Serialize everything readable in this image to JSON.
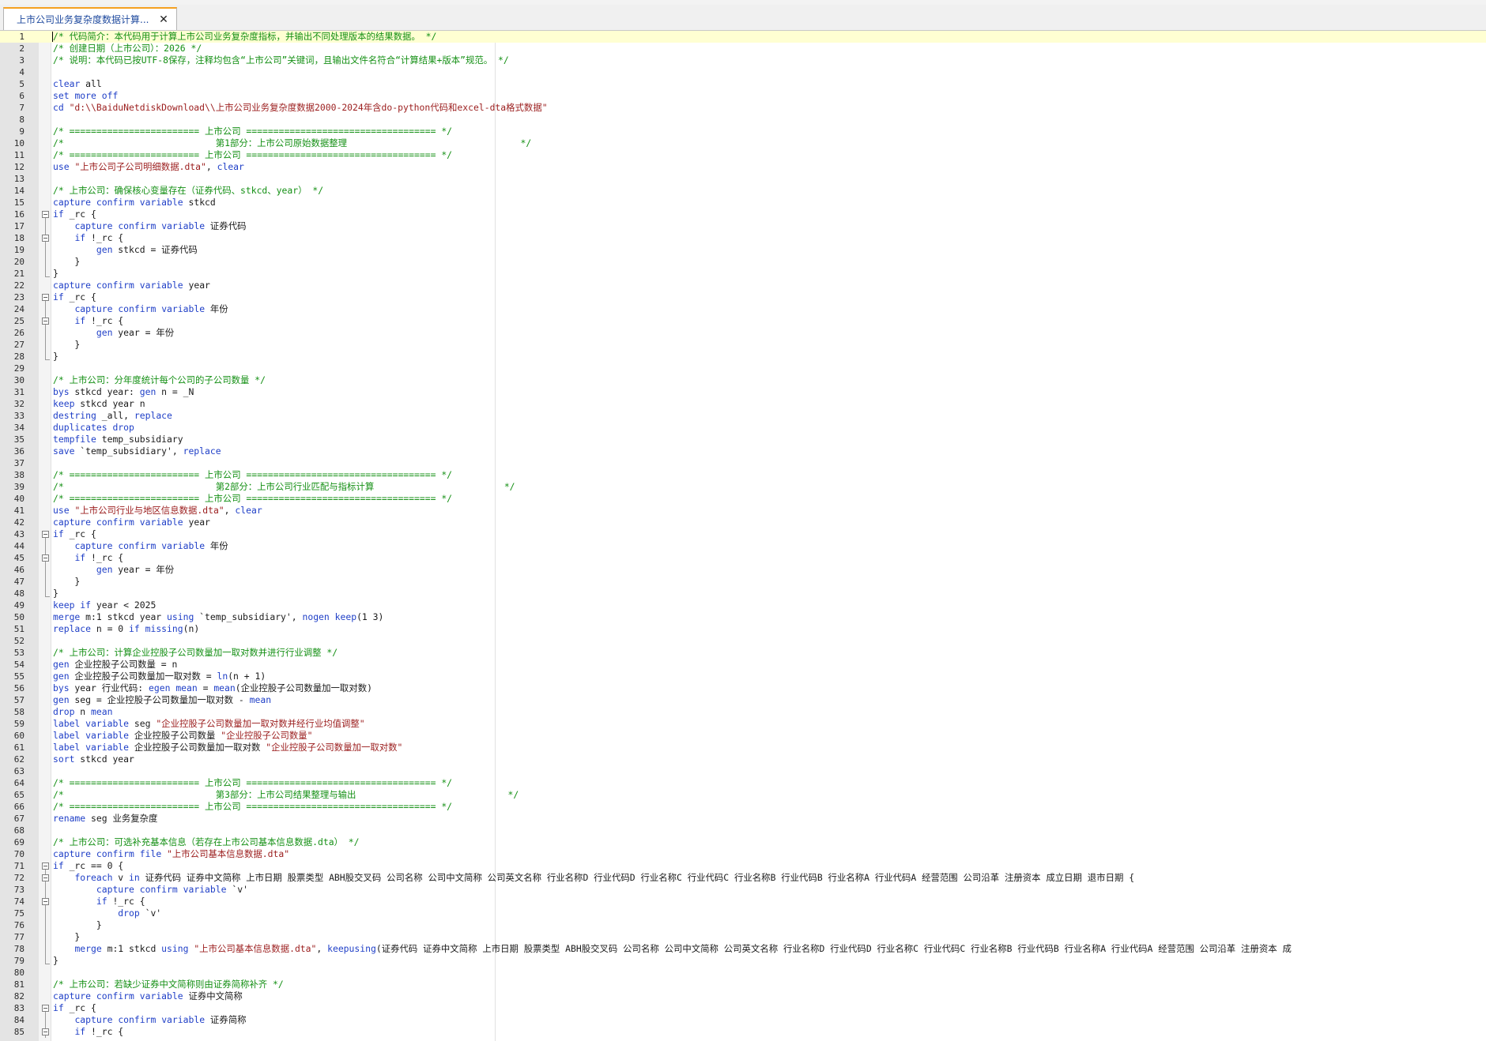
{
  "tabs": [
    {
      "label": "上市公司业务复杂度数据计算..."
    }
  ],
  "close_glyph": "✕",
  "colors": {
    "keyword": "#1f3fc7",
    "string": "#9b1d1d",
    "comment": "#159015",
    "text": "#1a1a1a",
    "current_line": "#ffffd2",
    "tab_accent": "#f5a020"
  },
  "editor": {
    "current_line": 1,
    "lines": [
      {
        "n": "1",
        "text": "/* 代码简介：本代码用于计算上市公司业务复杂度指标，并输出不同处理版本的结果数据。 */"
      },
      {
        "n": "2",
        "text": "/* 创建日期（上市公司）：2026 */"
      },
      {
        "n": "3",
        "text": "/* 说明：本代码已按UTF-8保存，注释均包含“上市公司”关键词，且输出文件名符合“计算结果+版本”规范。 */"
      },
      {
        "n": "4",
        "text": ""
      },
      {
        "n": "5",
        "text": "clear all"
      },
      {
        "n": "6",
        "text": "set more off"
      },
      {
        "n": "7",
        "text": "cd \"d:\\\\BaiduNetdiskDownload\\\\上市公司业务复杂度数据2000-2024年含do-python代码和excel-dta格式数据\""
      },
      {
        "n": "8",
        "text": ""
      },
      {
        "n": "9",
        "text": "/* ======================== 上市公司 =================================== */"
      },
      {
        "n": "10",
        "text": "/*                            第1部分：上市公司原始数据整理                                */"
      },
      {
        "n": "11",
        "text": "/* ======================== 上市公司 =================================== */"
      },
      {
        "n": "12",
        "text": "use \"上市公司子公司明细数据.dta\", clear"
      },
      {
        "n": "13",
        "text": ""
      },
      {
        "n": "14",
        "text": "/* 上市公司：确保核心变量存在（证券代码、stkcd、year） */"
      },
      {
        "n": "15",
        "text": "capture confirm variable stkcd"
      },
      {
        "n": "16",
        "text": "if _rc {"
      },
      {
        "n": "17",
        "text": "    capture confirm variable 证券代码"
      },
      {
        "n": "18",
        "text": "    if !_rc {"
      },
      {
        "n": "19",
        "text": "        gen stkcd = 证券代码"
      },
      {
        "n": "20",
        "text": "    }"
      },
      {
        "n": "21",
        "text": "}"
      },
      {
        "n": "22",
        "text": "capture confirm variable year"
      },
      {
        "n": "23",
        "text": "if _rc {"
      },
      {
        "n": "24",
        "text": "    capture confirm variable 年份"
      },
      {
        "n": "25",
        "text": "    if !_rc {"
      },
      {
        "n": "26",
        "text": "        gen year = 年份"
      },
      {
        "n": "27",
        "text": "    }"
      },
      {
        "n": "28",
        "text": "}"
      },
      {
        "n": "29",
        "text": ""
      },
      {
        "n": "30",
        "text": "/* 上市公司：分年度统计每个公司的子公司数量 */"
      },
      {
        "n": "31",
        "text": "bys stkcd year: gen n = _N"
      },
      {
        "n": "32",
        "text": "keep stkcd year n"
      },
      {
        "n": "33",
        "text": "destring _all, replace"
      },
      {
        "n": "34",
        "text": "duplicates drop"
      },
      {
        "n": "35",
        "text": "tempfile temp_subsidiary"
      },
      {
        "n": "36",
        "text": "save `temp_subsidiary', replace"
      },
      {
        "n": "37",
        "text": ""
      },
      {
        "n": "38",
        "text": "/* ======================== 上市公司 =================================== */"
      },
      {
        "n": "39",
        "text": "/*                            第2部分：上市公司行业匹配与指标计算                        */"
      },
      {
        "n": "40",
        "text": "/* ======================== 上市公司 =================================== */"
      },
      {
        "n": "41",
        "text": "use \"上市公司行业与地区信息数据.dta\", clear"
      },
      {
        "n": "42",
        "text": "capture confirm variable year"
      },
      {
        "n": "43",
        "text": "if _rc {"
      },
      {
        "n": "44",
        "text": "    capture confirm variable 年份"
      },
      {
        "n": "45",
        "text": "    if !_rc {"
      },
      {
        "n": "46",
        "text": "        gen year = 年份"
      },
      {
        "n": "47",
        "text": "    }"
      },
      {
        "n": "48",
        "text": "}"
      },
      {
        "n": "49",
        "text": "keep if year < 2025"
      },
      {
        "n": "50",
        "text": "merge m:1 stkcd year using `temp_subsidiary', nogen keep(1 3)"
      },
      {
        "n": "51",
        "text": "replace n = 0 if missing(n)"
      },
      {
        "n": "52",
        "text": ""
      },
      {
        "n": "53",
        "text": "/* 上市公司：计算企业控股子公司数量加一取对数并进行行业调整 */"
      },
      {
        "n": "54",
        "text": "gen 企业控股子公司数量 = n"
      },
      {
        "n": "55",
        "text": "gen 企业控股子公司数量加一取对数 = ln(n + 1)"
      },
      {
        "n": "56",
        "text": "bys year 行业代码: egen mean = mean(企业控股子公司数量加一取对数)"
      },
      {
        "n": "57",
        "text": "gen seg = 企业控股子公司数量加一取对数 - mean"
      },
      {
        "n": "58",
        "text": "drop n mean"
      },
      {
        "n": "59",
        "text": "label variable seg \"企业控股子公司数量加一取对数并经行业均值调整\""
      },
      {
        "n": "60",
        "text": "label variable 企业控股子公司数量 \"企业控股子公司数量\""
      },
      {
        "n": "61",
        "text": "label variable 企业控股子公司数量加一取对数 \"企业控股子公司数量加一取对数\""
      },
      {
        "n": "62",
        "text": "sort stkcd year"
      },
      {
        "n": "63",
        "text": ""
      },
      {
        "n": "64",
        "text": "/* ======================== 上市公司 =================================== */"
      },
      {
        "n": "65",
        "text": "/*                            第3部分：上市公司结果整理与输出                            */"
      },
      {
        "n": "66",
        "text": "/* ======================== 上市公司 =================================== */"
      },
      {
        "n": "67",
        "text": "rename seg 业务复杂度"
      },
      {
        "n": "68",
        "text": ""
      },
      {
        "n": "69",
        "text": "/* 上市公司：可选补充基本信息（若存在上市公司基本信息数据.dta） */"
      },
      {
        "n": "70",
        "text": "capture confirm file \"上市公司基本信息数据.dta\""
      },
      {
        "n": "71",
        "text": "if _rc == 0 {"
      },
      {
        "n": "72",
        "text": "    foreach v in 证券代码 证券中文简称 上市日期 股票类型 ABH股交叉码 公司名称 公司中文简称 公司英文名称 行业名称D 行业代码D 行业名称C 行业代码C 行业名称B 行业代码B 行业名称A 行业代码A 经营范围 公司沿革 注册资本 成立日期 退市日期 {"
      },
      {
        "n": "73",
        "text": "        capture confirm variable `v'"
      },
      {
        "n": "74",
        "text": "        if !_rc {"
      },
      {
        "n": "75",
        "text": "            drop `v'"
      },
      {
        "n": "76",
        "text": "        }"
      },
      {
        "n": "77",
        "text": "    }"
      },
      {
        "n": "78",
        "text": "    merge m:1 stkcd using \"上市公司基本信息数据.dta\", keepusing(证券代码 证券中文简称 上市日期 股票类型 ABH股交叉码 公司名称 公司中文简称 公司英文名称 行业名称D 行业代码D 行业名称C 行业代码C 行业名称B 行业代码B 行业名称A 行业代码A 经营范围 公司沿革 注册资本 成"
      },
      {
        "n": "79",
        "text": "}"
      },
      {
        "n": "80",
        "text": ""
      },
      {
        "n": "81",
        "text": "/* 上市公司：若缺少证券中文简称则由证券简称补齐 */"
      },
      {
        "n": "82",
        "text": "capture confirm variable 证券中文简称"
      },
      {
        "n": "83",
        "text": "if _rc {"
      },
      {
        "n": "84",
        "text": "    capture confirm variable 证券简称"
      },
      {
        "n": "85",
        "text": "    if !_rc {"
      }
    ]
  }
}
